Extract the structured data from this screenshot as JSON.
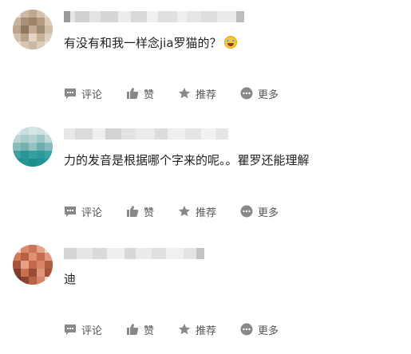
{
  "comments": [
    {
      "username": "",
      "text": "有没有和我一样念jia罗猫的？",
      "emoji": "laughing-crying-emoji",
      "actions": {
        "comment": "评论",
        "like": "赞",
        "recommend": "推荐",
        "more": "更多"
      }
    },
    {
      "username": "",
      "text": "力的发音是根据哪个字来的呢。。瞿罗还能理解",
      "actions": {
        "comment": "评论",
        "like": "赞",
        "recommend": "推荐",
        "more": "更多"
      }
    },
    {
      "username": "",
      "text": "迪",
      "actions": {
        "comment": "评论",
        "like": "赞",
        "recommend": "推荐",
        "more": "更多"
      }
    }
  ],
  "colors": {
    "icon": "#888888",
    "action_text": "#555555",
    "comment_text": "#222222",
    "blur_light": "#ececec",
    "blur_mid": "#d6d6d6"
  }
}
